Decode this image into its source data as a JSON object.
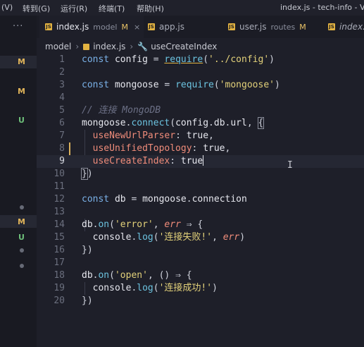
{
  "menubar": {
    "items": [
      "(V)",
      "转到(G)",
      "运行(R)",
      "终端(T)",
      "帮助(H)"
    ],
    "title": "index.js - tech-info - Vis"
  },
  "tabs": [
    {
      "icon": "JS",
      "name": "index.js",
      "folder": "model",
      "status": "M",
      "close": "×",
      "active": true
    },
    {
      "icon": "JS",
      "name": "app.js",
      "folder": "",
      "status": "",
      "close": "",
      "active": false
    },
    {
      "icon": "JS",
      "name": "user.js",
      "folder": "routes",
      "status": "M",
      "close": "",
      "active": false
    },
    {
      "icon": "JS",
      "name": "index.js",
      "folder": "",
      "status": "",
      "close": "",
      "active": false
    }
  ],
  "ellipsis": "···",
  "breadcrumb": {
    "folder": "model",
    "file": "index.js",
    "symbol": "useCreateIndex"
  },
  "git_markers": [
    {
      "label": "M",
      "type": "m"
    },
    {
      "label": "M",
      "type": "m"
    },
    {
      "label": "U",
      "type": "u"
    },
    {
      "label": "M",
      "type": "m"
    },
    {
      "label": "U",
      "type": "u"
    }
  ],
  "editor": {
    "current_line": 9,
    "lines": [
      {
        "n": "1",
        "code": [
          [
            "kw",
            "const "
          ],
          [
            "var",
            "config"
          ],
          [
            "punc",
            " = "
          ],
          [
            "fn underline",
            "require"
          ],
          [
            "punc",
            "("
          ],
          [
            "str",
            "'../config'"
          ],
          [
            "punc",
            ")"
          ]
        ]
      },
      {
        "n": "2",
        "code": []
      },
      {
        "n": "3",
        "code": [
          [
            "kw",
            "const "
          ],
          [
            "var",
            "mongoose"
          ],
          [
            "punc",
            " = "
          ],
          [
            "fn",
            "require"
          ],
          [
            "punc",
            "("
          ],
          [
            "str",
            "'mongoose'"
          ],
          [
            "punc",
            ")"
          ]
        ]
      },
      {
        "n": "4",
        "code": []
      },
      {
        "n": "5",
        "code": [
          [
            "cmt",
            "// 连接 MongoDB"
          ]
        ]
      },
      {
        "n": "6",
        "code": [
          [
            "var",
            "mongoose"
          ],
          [
            "punc",
            "."
          ],
          [
            "fn",
            "connect"
          ],
          [
            "punc",
            "("
          ],
          [
            "var",
            "config"
          ],
          [
            "punc",
            "."
          ],
          [
            "var",
            "db"
          ],
          [
            "punc",
            "."
          ],
          [
            "var",
            "url"
          ],
          [
            "punc",
            ", "
          ],
          [
            "punc bracket-box",
            "{"
          ]
        ]
      },
      {
        "n": "7",
        "code": [
          [
            "punc",
            "  "
          ],
          [
            "prop",
            "useNewUrlParser"
          ],
          [
            "punc",
            ": "
          ],
          [
            "bool",
            "true"
          ],
          [
            "punc",
            ","
          ]
        ]
      },
      {
        "n": "8",
        "code": [
          [
            "punc",
            "  "
          ],
          [
            "prop",
            "useUnifiedTopology"
          ],
          [
            "punc",
            ": "
          ],
          [
            "bool",
            "true"
          ],
          [
            "punc",
            ","
          ]
        ]
      },
      {
        "n": "9",
        "code": [
          [
            "punc",
            "  "
          ],
          [
            "prop",
            "useCreateIndex"
          ],
          [
            "punc",
            ": "
          ],
          [
            "bool",
            "true"
          ]
        ]
      },
      {
        "n": "10",
        "code": [
          [
            "punc bracket-box",
            "}"
          ],
          [
            "punc",
            ")"
          ]
        ]
      },
      {
        "n": "11",
        "code": []
      },
      {
        "n": "12",
        "code": [
          [
            "kw",
            "const "
          ],
          [
            "var",
            "db"
          ],
          [
            "punc",
            " = "
          ],
          [
            "var",
            "mongoose"
          ],
          [
            "punc",
            "."
          ],
          [
            "var",
            "connection"
          ]
        ]
      },
      {
        "n": "13",
        "code": []
      },
      {
        "n": "14",
        "code": [
          [
            "var",
            "db"
          ],
          [
            "punc",
            "."
          ],
          [
            "fn",
            "on"
          ],
          [
            "punc",
            "("
          ],
          [
            "str",
            "'error'"
          ],
          [
            "punc",
            ", "
          ],
          [
            "param",
            "err"
          ],
          [
            "punc",
            " ⇒ {"
          ]
        ]
      },
      {
        "n": "15",
        "code": [
          [
            "punc",
            "  "
          ],
          [
            "var",
            "console"
          ],
          [
            "punc",
            "."
          ],
          [
            "fn",
            "log"
          ],
          [
            "punc",
            "("
          ],
          [
            "str",
            "'连接失败!'"
          ],
          [
            "punc",
            ", "
          ],
          [
            "param",
            "err"
          ],
          [
            "punc",
            ")"
          ]
        ]
      },
      {
        "n": "16",
        "code": [
          [
            "punc",
            "})"
          ]
        ]
      },
      {
        "n": "17",
        "code": []
      },
      {
        "n": "18",
        "code": [
          [
            "var",
            "db"
          ],
          [
            "punc",
            "."
          ],
          [
            "fn",
            "on"
          ],
          [
            "punc",
            "("
          ],
          [
            "str",
            "'open'"
          ],
          [
            "punc",
            ", () ⇒ {"
          ]
        ]
      },
      {
        "n": "19",
        "code": [
          [
            "punc",
            "  "
          ],
          [
            "var",
            "console"
          ],
          [
            "punc",
            "."
          ],
          [
            "fn",
            "log"
          ],
          [
            "punc",
            "("
          ],
          [
            "str",
            "'连接成功!'"
          ],
          [
            "punc",
            ")"
          ]
        ]
      },
      {
        "n": "20",
        "code": [
          [
            "punc",
            "})"
          ]
        ]
      }
    ]
  },
  "colors": {
    "background": "#1e1f29",
    "modified": "#e0b45a",
    "untracked": "#6ec07a",
    "keyword": "#7ab1e8",
    "string": "#e3d17a",
    "property": "#f08c7a"
  }
}
